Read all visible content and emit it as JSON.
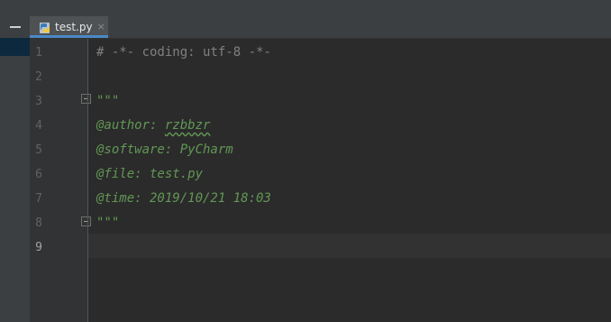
{
  "tab": {
    "label": "test.py",
    "close_glyph": "×",
    "icon": "python-file-icon"
  },
  "gutter": {
    "line_numbers": [
      "1",
      "2",
      "3",
      "4",
      "5",
      "6",
      "7",
      "8",
      "9"
    ],
    "current_line": "9"
  },
  "code": {
    "line1": "# -*- coding: utf-8 -*-",
    "line3": "\"\"\"",
    "line4_prefix": "@author: ",
    "line4_name": "rzbbzr",
    "line5": "@software: PyCharm",
    "line6": "@file: test.py",
    "line7": "@time: 2019/10/21 18:03",
    "line8": "\"\"\""
  },
  "colors": {
    "background": "#2b2b2b",
    "comment": "#808080",
    "docstring": "#629755",
    "accent": "#4a88c7"
  }
}
